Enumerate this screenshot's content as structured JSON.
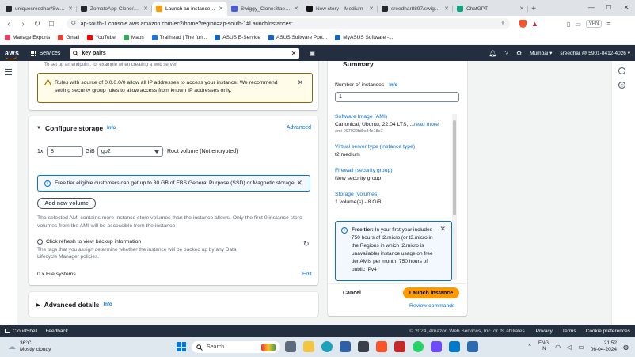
{
  "browser": {
    "tabs": [
      {
        "title": "uniquesreedhar/Swiggy_C",
        "active": false,
        "color": "#24292f"
      },
      {
        "title": "ZomatoApp-Clone/Githu",
        "active": false,
        "color": "#24292f"
      },
      {
        "title": "Launch an instance | EC2",
        "active": true,
        "color": "#ff9900"
      },
      {
        "title": "Swiggy_Clone:8fae6ef6-",
        "active": false,
        "color": "#4b5bd6"
      },
      {
        "title": "New story – Medium",
        "active": false,
        "color": "#111111"
      },
      {
        "title": "sreedhar8897/swiggy Ta",
        "active": false,
        "color": "#24292f"
      },
      {
        "title": "ChatGPT",
        "active": false,
        "color": "#10a37f"
      }
    ],
    "url": "ap-south-1.console.aws.amazon.com/ec2/home?region=ap-south-1#LaunchInstances:",
    "vpn_label": "VPN",
    "bookmarks": [
      {
        "label": "Manage Exports",
        "color": "#e63d5a"
      },
      {
        "label": "Gmail",
        "color": "#ea4335"
      },
      {
        "label": "YouTube",
        "color": "#ff0000"
      },
      {
        "label": "Maps",
        "color": "#34a853"
      },
      {
        "label": "Trailhead | The fun...",
        "color": "#1a73e8"
      },
      {
        "label": "ASUS E-Service",
        "color": "#1565c0"
      },
      {
        "label": "ASUS Software Port...",
        "color": "#1565c0"
      },
      {
        "label": "MyASUS Software -...",
        "color": "#1565c0"
      }
    ]
  },
  "aws_header": {
    "logo": "aws",
    "services_label": "Services",
    "search_value": "key pairs",
    "region": "Mumbai",
    "account": "sreedhar @ 5901-8412-4026"
  },
  "main": {
    "top_hint": "To set up an endpoint, for example when creating a web server",
    "warning_text": "Rules with source of 0.0.0.0/0 allow all IP addresses to access your instance. We recommend setting security group rules to allow access from known IP addresses only.",
    "storage": {
      "title": "Configure storage",
      "info": "Info",
      "advanced": "Advanced",
      "multiplier": "1x",
      "size_value": "8",
      "unit": "GiB",
      "volume_type": "gp2",
      "volume_desc": "Root volume  (Not encrypted)",
      "free_tier_text": "Free tier eligible customers can get up to 30 GB of EBS General Purpose (SSD) or Magnetic storage",
      "add_volume_label": "Add new volume",
      "ami_note": "The selected AMI contains more instance store volumes than the instance allows. Only the first 0 instance store volumes from the AMI will be accessible from the instance",
      "backup_title": "Click refresh to view backup information",
      "backup_desc": "The tags that you assign determine whether the instance will be backed up by any Data Lifecycle Manager policies.",
      "file_systems": "0 x File systems",
      "edit": "Edit"
    },
    "advanced_details": {
      "title": "Advanced details",
      "info": "Info"
    }
  },
  "summary": {
    "title": "Summary",
    "instances_label": "Number of instances",
    "info": "Info",
    "instances_value": "1",
    "ami_label": "Software Image (AMI)",
    "ami_value": "Canonical, Ubuntu, 22.04 LTS, ...",
    "read_more": "read more",
    "ami_id": "ami-007020fd9c84e18c7",
    "type_label": "Virtual server type (instance type)",
    "type_value": "t2.medium",
    "firewall_label": "Firewall (security group)",
    "firewall_value": "New security group",
    "storage_label": "Storage (volumes)",
    "storage_value": "1 volume(s) - 8 GiB",
    "free_tier_bold": "Free tier:",
    "free_tier_text": " In your first year includes 750 hours of t2.micro (or t3.micro in the Regions in which t2.micro is unavailable) instance usage on free tier AMIs per month, 750 hours of public IPv4",
    "cancel": "Cancel",
    "launch": "Launch instance",
    "review": "Review commands"
  },
  "footer": {
    "cloudshell": "CloudShell",
    "feedback": "Feedback",
    "copyright": "© 2024, Amazon Web Services, Inc. or its affiliates.",
    "privacy": "Privacy",
    "terms": "Terms",
    "cookies": "Cookie preferences"
  },
  "taskbar": {
    "temp": "36°C",
    "weather": "Mostly cloudy",
    "search": "Search",
    "lang1": "ENG",
    "lang2": "IN",
    "time": "21:52",
    "date": "06-04-2024"
  }
}
